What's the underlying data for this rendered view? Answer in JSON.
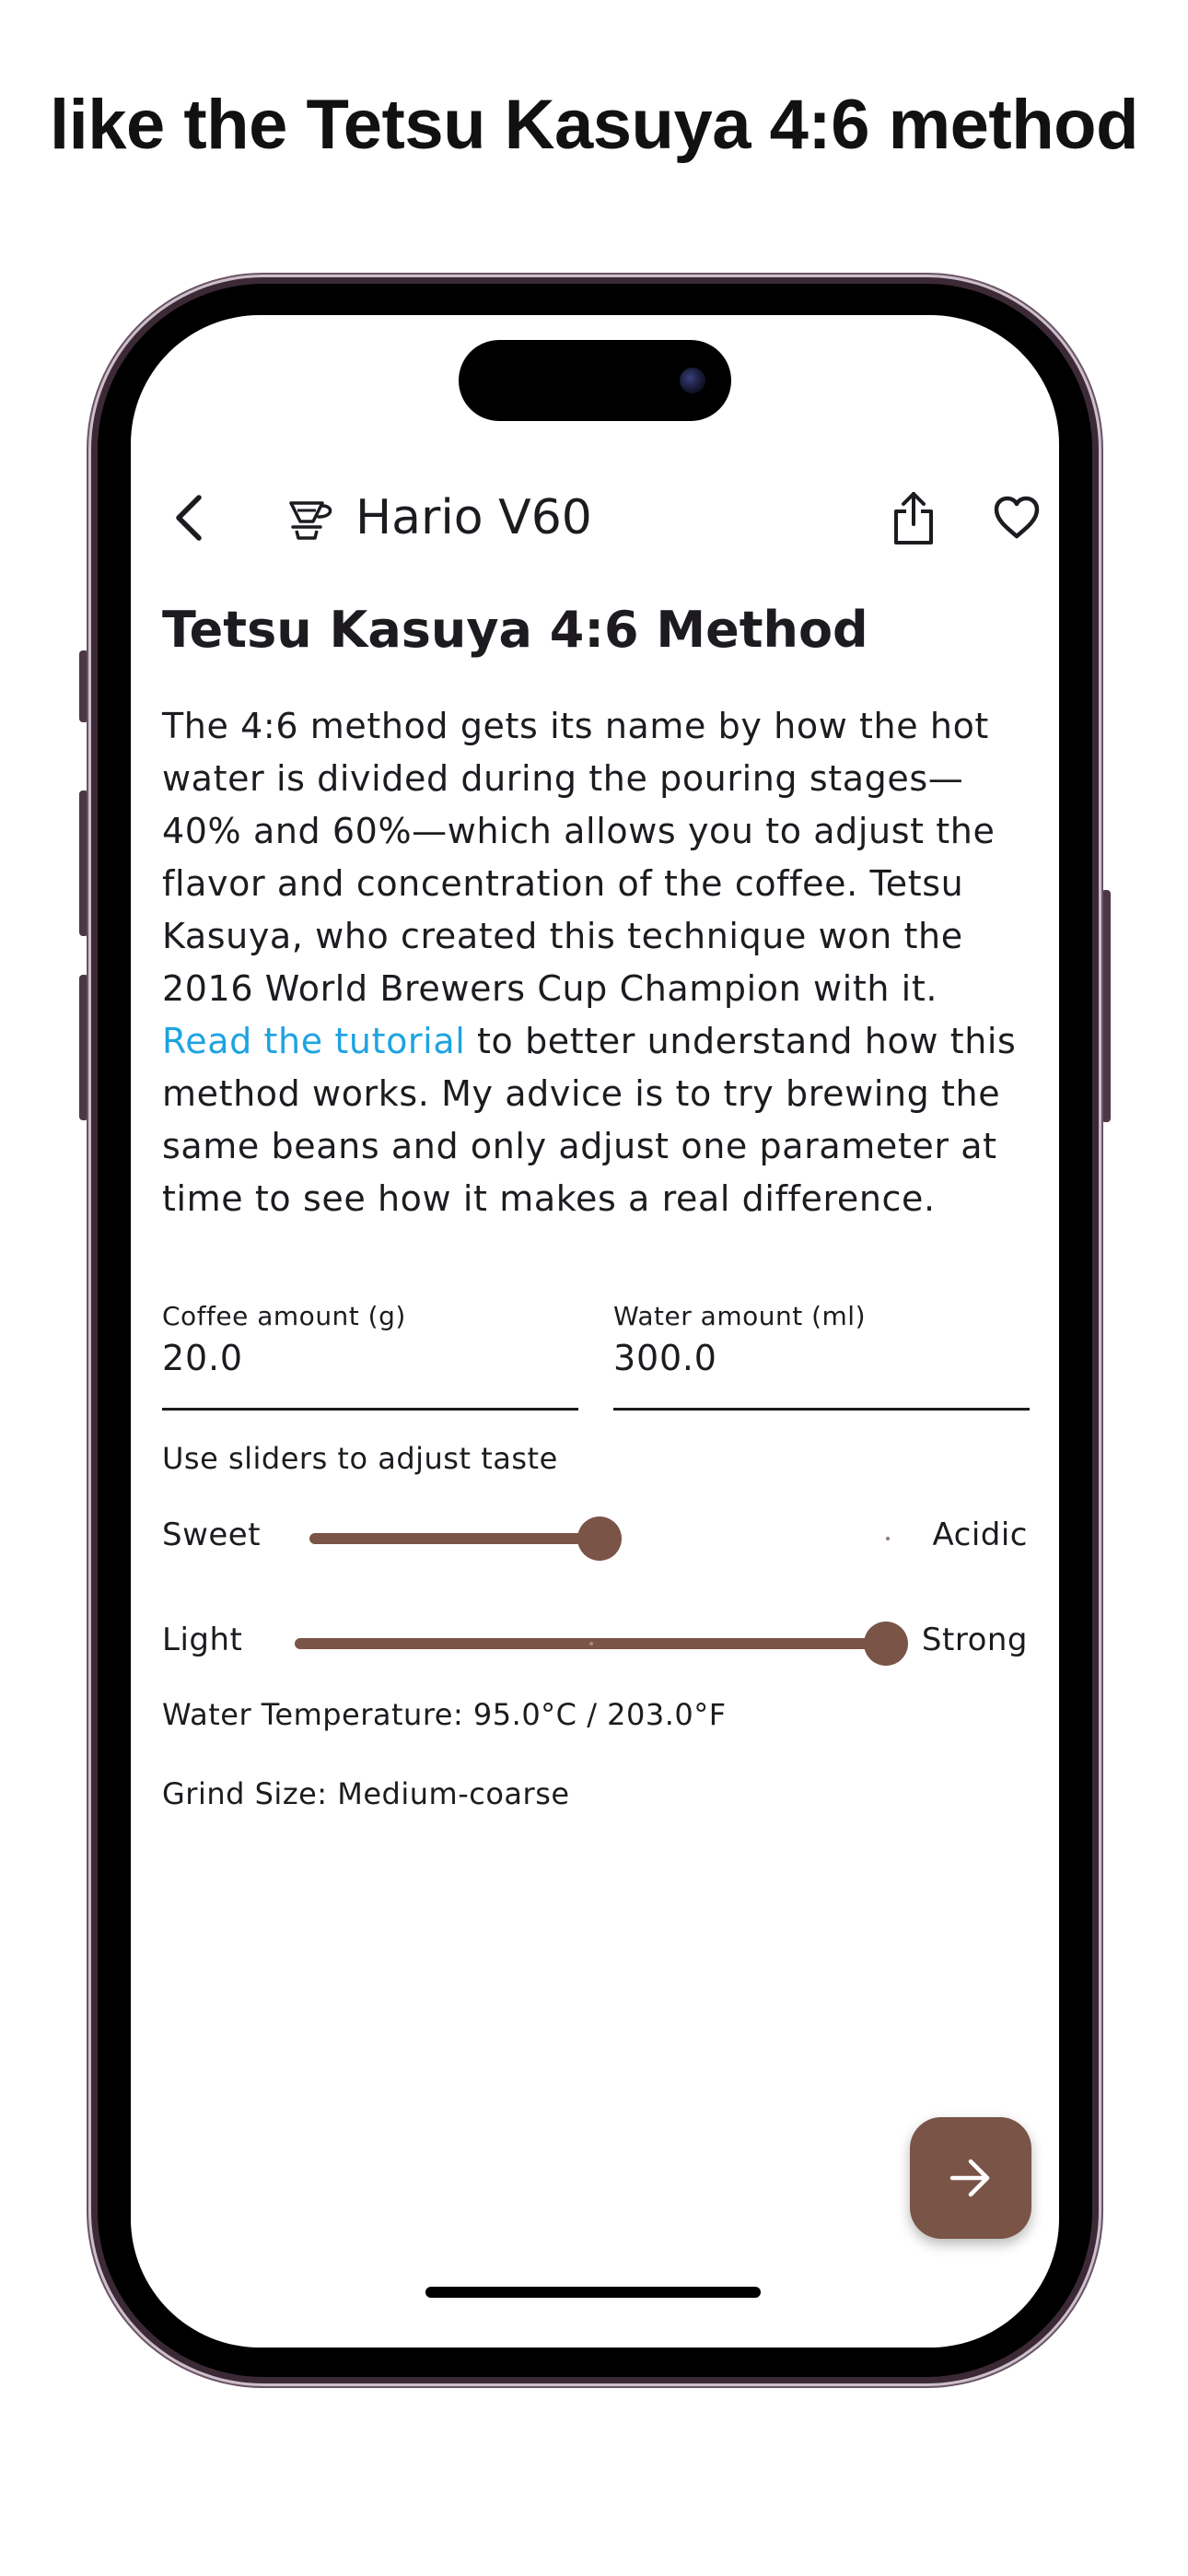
{
  "marketing": {
    "headline": "like the Tetsu Kasuya 4:6 method"
  },
  "appbar": {
    "title": "Hario V60",
    "icons": {
      "back": "back-chevron-icon",
      "brewer": "pour-over-dripper-icon",
      "share": "share-icon",
      "favorite": "heart-outline-icon"
    }
  },
  "recipe": {
    "title": "Tetsu Kasuya 4:6 Method",
    "description_before_link": "The 4:6 method gets its name by how the hot water is divided during the pouring stages—40% and 60%—which allows you to adjust the flavor and concentration of the coffee. Tetsu Kasuya, who created this technique won the 2016 World Brewers Cup Champion with it. ",
    "link_text": "Read the tutorial",
    "description_after_link": " to better understand how this method works. My advice is to try brewing the same beans and only adjust one parameter at time to see how it makes a real difference."
  },
  "inputs": {
    "coffee": {
      "label": "Coffee amount (g)",
      "value": "20.0"
    },
    "water": {
      "label": "Water amount (ml)",
      "value": "300.0"
    }
  },
  "sliders": {
    "hint": "Use sliders to adjust taste",
    "taste": {
      "left_label": "Sweet",
      "right_label": "Acidic",
      "position": 0.5
    },
    "strength": {
      "left_label": "Light",
      "right_label": "Strong",
      "position": 1.0
    }
  },
  "info": {
    "temperature": "Water Temperature: 95.0°C / 203.0°F",
    "grind": "Grind Size: Medium-coarse"
  },
  "fab": {
    "icon": "arrow-right-icon"
  },
  "colors": {
    "accent": "#7a5446",
    "link": "#1ea3e0",
    "text": "#1d1b20",
    "phone_frame": "#3b2a36"
  }
}
